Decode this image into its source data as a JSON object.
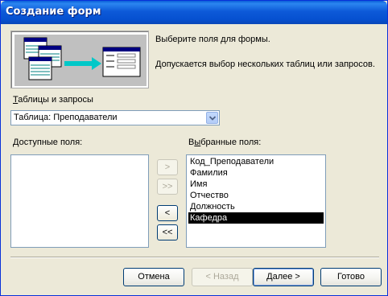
{
  "window": {
    "title": "Создание форм"
  },
  "description": {
    "line1": "Выберите поля для формы.",
    "line2": "Допускается выбор нескольких таблиц или запросов."
  },
  "source": {
    "label": "Таблицы и запросы",
    "label_hotkey": "Т",
    "label_rest": "аблицы и запросы",
    "selected": "Таблица: Преподаватели"
  },
  "available": {
    "label_hotkey": "Д",
    "label_rest": "оступные поля:",
    "items": []
  },
  "selected_fields": {
    "label_pre": "В",
    "label_hotkey": "ы",
    "label_rest": "бранные поля:",
    "items": [
      "Код_Преподаватели",
      "Фамилия",
      "Имя",
      "Отчество",
      "Должность",
      "Кафедра"
    ],
    "selected_item": "Кафедра"
  },
  "move_buttons": {
    "add_one": ">",
    "add_all": ">>",
    "remove_one": "<",
    "remove_all": "<<"
  },
  "footer": {
    "cancel": "Отмена",
    "back": "< Назад",
    "next": "Далее >",
    "finish": "Готово"
  },
  "colors": {
    "title_bar": "#0a5fd9",
    "selection": "#000000",
    "dialog_bg": "#ece9d8"
  },
  "icons": {
    "illustration": "tables-to-form-illustration",
    "combo_arrow": "chevron-down-icon"
  }
}
